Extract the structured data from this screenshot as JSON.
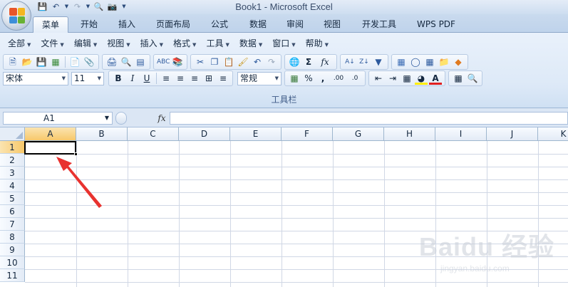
{
  "window": {
    "title": "Book1 - Microsoft Excel"
  },
  "quick_access": {
    "icons": [
      "save-icon",
      "undo-icon",
      "redo-icon",
      "print-preview-icon",
      "camera-icon",
      "customize-icon"
    ]
  },
  "ribbon_tabs": [
    {
      "label": "菜单",
      "active": true
    },
    {
      "label": "开始",
      "active": false
    },
    {
      "label": "插入",
      "active": false
    },
    {
      "label": "页面布局",
      "active": false
    },
    {
      "label": "公式",
      "active": false
    },
    {
      "label": "数据",
      "active": false
    },
    {
      "label": "审阅",
      "active": false
    },
    {
      "label": "视图",
      "active": false
    },
    {
      "label": "开发工具",
      "active": false
    },
    {
      "label": "WPS PDF",
      "active": false
    }
  ],
  "menu": {
    "items": [
      "全部",
      "文件",
      "编辑",
      "视图",
      "插入",
      "格式",
      "工具",
      "数据",
      "窗口",
      "帮助"
    ]
  },
  "format": {
    "font_name": "宋体",
    "font_size": "11",
    "bold": "B",
    "italic": "I",
    "underline": "U",
    "number_format": "常规",
    "percent": "%",
    "comma": ",",
    "sum_symbol": "Σ",
    "fx_symbol": "fx",
    "font_color_letter": "A",
    "dec_increase": ".00",
    "dec_decrease": ".0"
  },
  "ribbon_group_label": "工具栏",
  "formula_bar": {
    "name_box": "A1",
    "fx_label": "fx",
    "formula": ""
  },
  "sheet": {
    "columns": [
      "A",
      "B",
      "C",
      "D",
      "E",
      "F",
      "G",
      "H",
      "I",
      "J",
      "K"
    ],
    "rows": [
      "1",
      "2",
      "3",
      "4",
      "5",
      "6",
      "7",
      "8",
      "9",
      "10",
      "11"
    ],
    "active_cell": "A1"
  },
  "watermark": {
    "brand": "Baidu 经验",
    "url": "jingyan.baidu.com"
  },
  "colors": {
    "ribbon_bg": "#dde9f7",
    "tab_bar": "#bfd3eb",
    "selected_header": "#f7c86b",
    "annotation_arrow": "#e8322f",
    "gridline": "#d0d7e5"
  }
}
